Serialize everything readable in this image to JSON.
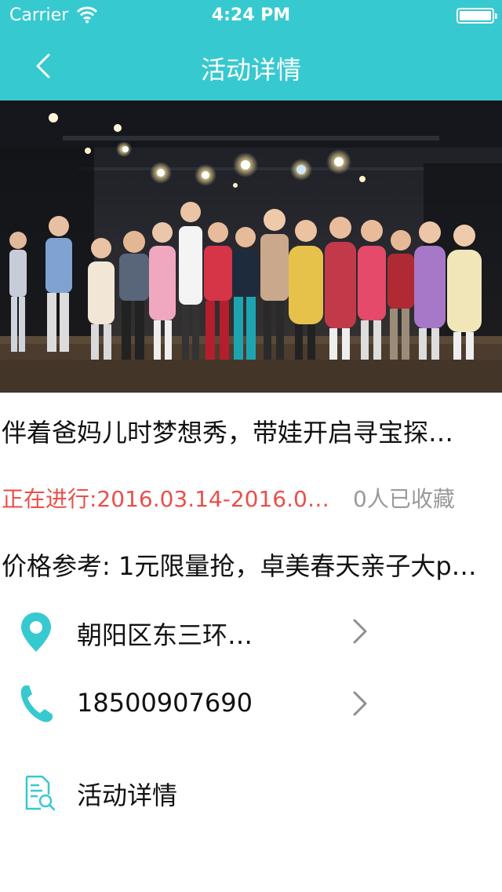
{
  "status_bar": {
    "carrier": "Carrier",
    "time": "4:24 PM"
  },
  "nav": {
    "title": "活动详情"
  },
  "hero": {
    "image": "children-stage-photo"
  },
  "event": {
    "title": "伴着爸妈儿时梦想秀，带娃开启寻宝探…",
    "status_date": "正在进行:2016.03.14-2016.0…",
    "favorites": "0人已收藏",
    "price": "价格参考: 1元限量抢，卓美春天亲子大p…"
  },
  "rows": {
    "address": "朝阳区东三环…",
    "phone": "18500907690",
    "details": "活动详情"
  },
  "colors": {
    "accent": "#37c9d0",
    "status": "#e9504a",
    "muted": "#9a9a9a"
  }
}
